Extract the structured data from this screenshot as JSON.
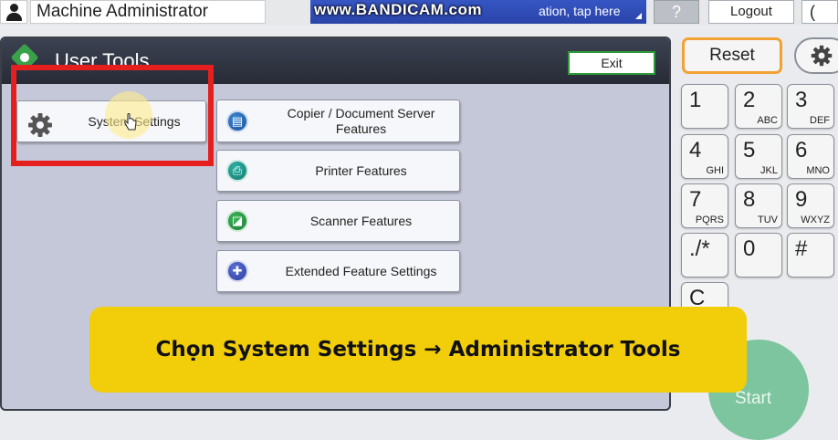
{
  "topbar": {
    "user_name": "Machine Administrator",
    "watermark": "www.BANDICAM.com",
    "status_text": "ation, tap here",
    "help_label": "?",
    "logout_label": "Logout",
    "cut_label": "("
  },
  "panel": {
    "title": "User Tools",
    "exit_label": "Exit",
    "buttons": {
      "system_settings": "System Settings",
      "copier": "Copier / Document Server Features",
      "printer": "Printer Features",
      "scanner": "Scanner Features",
      "extended": "Extended Feature Settings"
    }
  },
  "keypad": {
    "reset_label": "Reset",
    "keys": [
      {
        "num": "1",
        "sub": ""
      },
      {
        "num": "2",
        "sub": "ABC"
      },
      {
        "num": "3",
        "sub": "DEF"
      },
      {
        "num": "4",
        "sub": "GHI"
      },
      {
        "num": "5",
        "sub": "JKL"
      },
      {
        "num": "6",
        "sub": "MNO"
      },
      {
        "num": "7",
        "sub": "PQRS"
      },
      {
        "num": "8",
        "sub": "TUV"
      },
      {
        "num": "9",
        "sub": "WXYZ"
      },
      {
        "num": "./*",
        "sub": ""
      },
      {
        "num": "0",
        "sub": ""
      },
      {
        "num": "#",
        "sub": ""
      },
      {
        "num": "C",
        "sub": ""
      }
    ],
    "start_label": "Start"
  },
  "caption": "Chọn System Settings → Administrator Tools",
  "colors": {
    "highlight": "#e51e1e",
    "caption_bg": "#f2cd0a",
    "reset_border": "#f2a133",
    "start": "#7cc59e"
  }
}
